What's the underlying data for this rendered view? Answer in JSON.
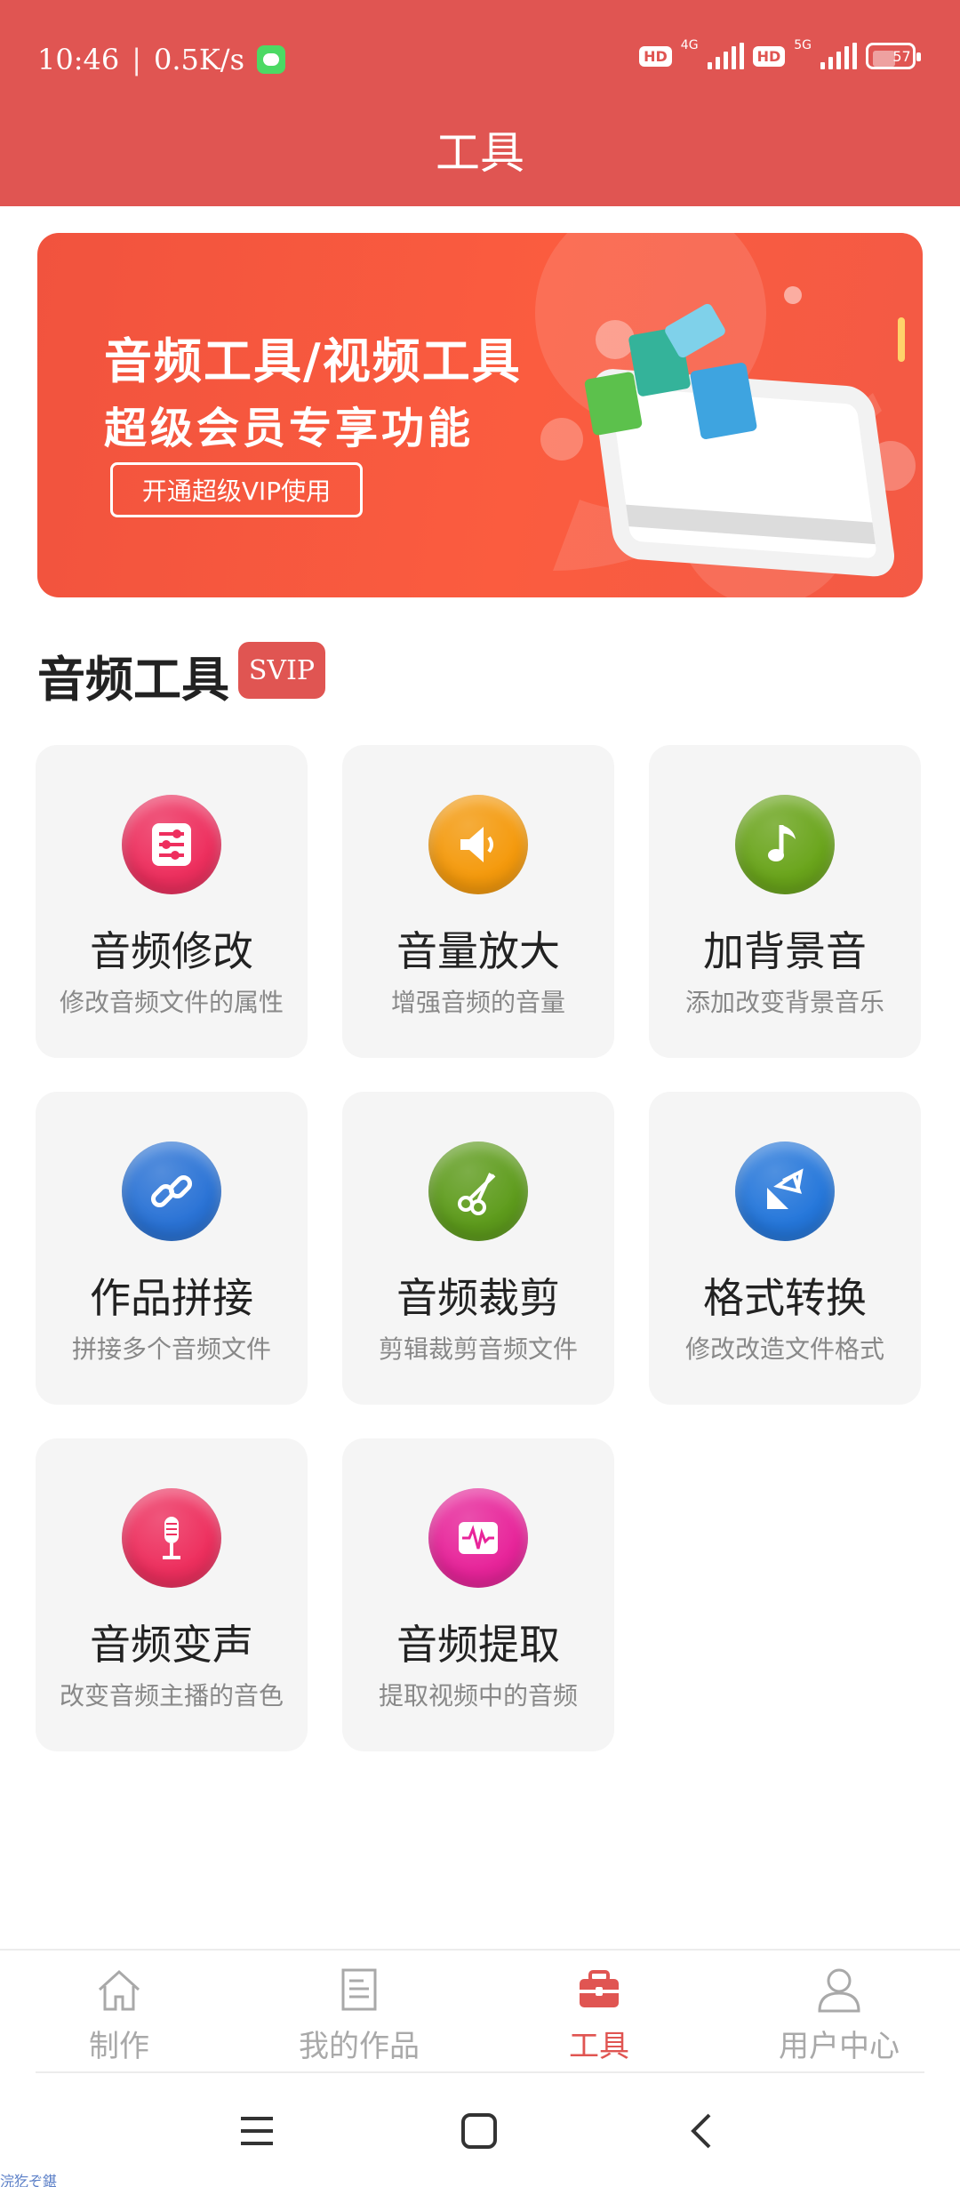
{
  "status_bar": {
    "time": "10:46",
    "separator": "|",
    "speed": "0.5K/s",
    "hd1": "HD",
    "net1": "4G",
    "hd2": "HD",
    "net2": "5G",
    "battery": "57"
  },
  "header": {
    "title": "工具"
  },
  "banner": {
    "title": "音频工具/视频工具",
    "subtitle": "超级会员专享功能",
    "button": "开通超级VIP使用"
  },
  "section": {
    "title": "音频工具",
    "badge": "SVIP"
  },
  "tools": [
    {
      "name": "音频修改",
      "desc": "修改音频文件的属性",
      "icon": "sliders-icon",
      "color": "#ee2f5e"
    },
    {
      "name": "音量放大",
      "desc": "增强音频的音量",
      "icon": "speaker-icon",
      "color": "#f59a0c"
    },
    {
      "name": "加背景音",
      "desc": "添加改变背景音乐",
      "icon": "music-note-icon",
      "color": "#6aa51b"
    },
    {
      "name": "作品拼接",
      "desc": "拼接多个音频文件",
      "icon": "link-icon",
      "color": "#2a73d6"
    },
    {
      "name": "音频裁剪",
      "desc": "剪辑裁剪音频文件",
      "icon": "scissors-icon",
      "color": "#5e9c1c"
    },
    {
      "name": "格式转换",
      "desc": "修改改造文件格式",
      "icon": "convert-arrows-icon",
      "color": "#2577db"
    },
    {
      "name": "音频变声",
      "desc": "改变音频主播的音色",
      "icon": "microphone-icon",
      "color": "#ee2f5e"
    },
    {
      "name": "音频提取",
      "desc": "提取视频中的音频",
      "icon": "waveform-icon",
      "color": "#e8249a"
    }
  ],
  "tabbar": {
    "items": [
      {
        "label": "制作",
        "icon": "home-icon"
      },
      {
        "label": "我的作品",
        "icon": "document-icon"
      },
      {
        "label": "工具",
        "icon": "toolbox-icon"
      },
      {
        "label": "用户中心",
        "icon": "user-icon"
      }
    ],
    "active": "工具",
    "active_color": "#e05552",
    "inactive_color": "#a9a9a9"
  },
  "watermark": "浣犵ぞ鍖",
  "colors": {
    "brand": "#e05552",
    "banner": "#f6573f"
  }
}
